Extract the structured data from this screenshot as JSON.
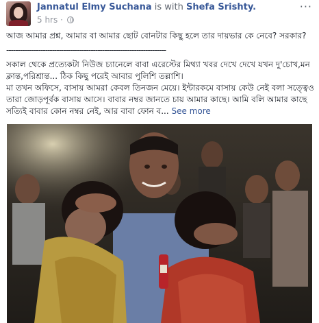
{
  "post": {
    "author": "Jannatul Elmy Suchana",
    "with_text": "is with",
    "tagged": "Shefa Srishty.",
    "time": "5 hrs",
    "menu_glyph": "···",
    "paragraph1": "আজ আমার প্রশ্ন, আমার বা আমার ছোট বোনটার কিছু হলে তার দায়ভার কে নেবে? সরকার?",
    "separator": "----------------------------------------------------------------------",
    "line1": "সকাল থেকে প্রত্যেকটা নিউজ চ্যানেলে বাবা এরেস্টের মিথ্যা খবর দেখে দেখে যখন দু'চোখ,মন",
    "line2": "ক্লান্ত,পরিশ্রান্ত... ঠিক কিছু পরেই আবার পুলিশি তল্লাশি।",
    "line3": "মা তখন অফিসে, বাসায় আমরা কেবল তিনজন মেয়ে। ইন্টারকমে বাসায় কেউ নেই বলা সত্ত্বেও",
    "line4": "তারা জোড়পূর্বক বাসায় আসে। বাবার নম্বর জানতে চায় আমার কাছে। আমি বলি আমার কাছে",
    "line5": "সত্যিই বাবার কোন নম্বর নেই, আর বাবা ফোন ব...",
    "see_more": "See more"
  },
  "icons": {
    "privacy": "globe-icon",
    "menu": "more-options-icon"
  }
}
